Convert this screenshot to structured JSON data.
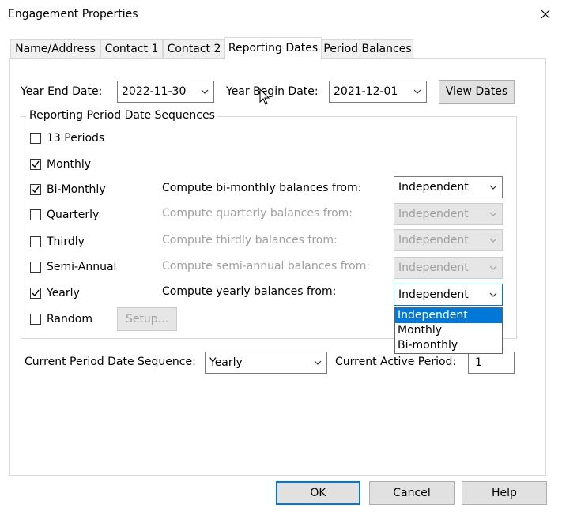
{
  "window": {
    "title": "Engagement Properties"
  },
  "tabs": [
    {
      "label": "Name/Address"
    },
    {
      "label": "Contact 1"
    },
    {
      "label": "Contact 2"
    },
    {
      "label": "Reporting Dates"
    },
    {
      "label": "Period Balances"
    }
  ],
  "dates": {
    "year_end_label": "Year End Date:",
    "year_end_value": "2022-11-30",
    "year_begin_label": "Year Begin Date:",
    "year_begin_value": "2021-12-01",
    "view_dates_label": "View Dates"
  },
  "sequences": {
    "group_label": "Reporting Period Date Sequences",
    "items": [
      {
        "label": "13 Periods",
        "checked": false
      },
      {
        "label": "Monthly",
        "checked": true
      },
      {
        "label": "Bi-Monthly",
        "checked": true,
        "compute_label": "Compute bi-monthly balances from:",
        "compute_value": "Independent",
        "enabled": true
      },
      {
        "label": "Quarterly",
        "checked": false,
        "compute_label": "Compute quarterly balances from:",
        "compute_value": "Independent",
        "enabled": false
      },
      {
        "label": "Thirdly",
        "checked": false,
        "compute_label": "Compute thirdly balances from:",
        "compute_value": "Independent",
        "enabled": false
      },
      {
        "label": "Semi-Annual",
        "checked": false,
        "compute_label": "Compute semi-annual balances from:",
        "compute_value": "Independent",
        "enabled": false
      },
      {
        "label": "Yearly",
        "checked": true,
        "compute_label": "Compute yearly balances from:",
        "compute_value": "Independent",
        "enabled": true
      },
      {
        "label": "Random",
        "checked": false
      }
    ],
    "setup_label": "Setup...",
    "dropdown_options": [
      "Independent",
      "Monthly",
      "Bi-monthly"
    ]
  },
  "current": {
    "sequence_label": "Current Period Date Sequence:",
    "sequence_value": "Yearly",
    "active_period_label": "Current Active Period:",
    "active_period_value": "1"
  },
  "footer": {
    "ok_label": "OK",
    "cancel_label": "Cancel",
    "help_label": "Help"
  },
  "colors": {
    "accent": "#0078d7",
    "disabled_text": "#a0a0a0"
  }
}
